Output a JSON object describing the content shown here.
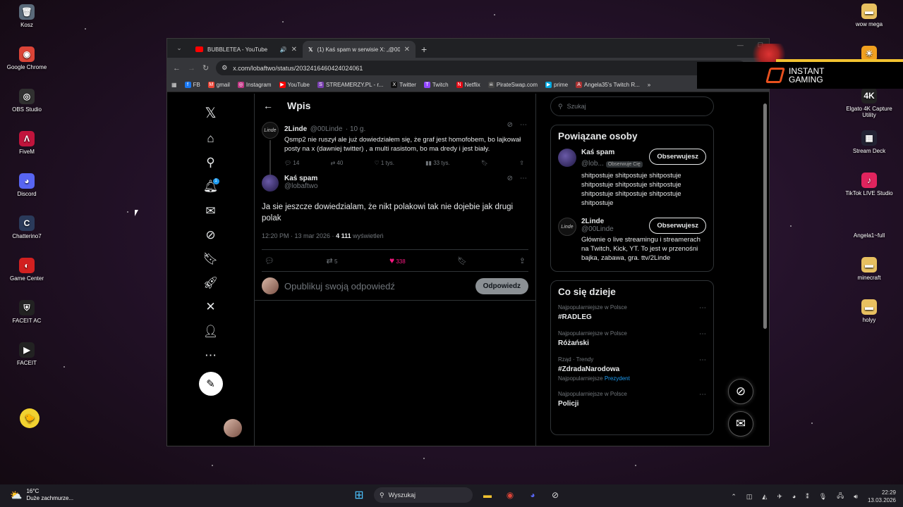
{
  "desktop": {
    "left_icons": [
      {
        "label": "Kosz",
        "icon": "recycle-bin-icon",
        "color": "#5a6a7a",
        "glyph": "🗑"
      },
      {
        "label": "Google Chrome",
        "icon": "chrome-icon",
        "color": "#db4437",
        "glyph": "◉"
      },
      {
        "label": "OBS Studio",
        "icon": "obs-icon",
        "color": "#303030",
        "glyph": "◎"
      },
      {
        "label": "FiveM",
        "icon": "fivem-icon",
        "color": "#c0143c",
        "glyph": "Λ"
      },
      {
        "label": "Discord",
        "icon": "discord-icon",
        "color": "#5865f2",
        "glyph": "◕"
      },
      {
        "label": "Chatterino7",
        "icon": "chatterino-icon",
        "color": "#2a3a5a",
        "glyph": "C"
      },
      {
        "label": "Game Center",
        "icon": "game-center-icon",
        "color": "#d22020",
        "glyph": "◐"
      },
      {
        "label": "FACEIT AC",
        "icon": "faceit-ac-icon",
        "color": "#222",
        "glyph": "⛨"
      },
      {
        "label": "FACEIT",
        "icon": "faceit-icon",
        "color": "#222",
        "glyph": "▶"
      }
    ],
    "right_icons": [
      {
        "label": "wow mega",
        "icon": "folder-icon",
        "color": "#e8c060",
        "glyph": "▬"
      },
      {
        "label": "",
        "icon": "sun-app-icon",
        "color": "#f0a020",
        "glyph": "☀"
      },
      {
        "label": "Elgato 4K Capture Utility",
        "icon": "elgato-icon",
        "color": "#222",
        "glyph": "4K"
      },
      {
        "label": "Stream Deck",
        "icon": "stream-deck-icon",
        "color": "#223",
        "glyph": "▦"
      },
      {
        "label": "TikTok LIVE Studio",
        "icon": "tiktok-icon",
        "color": "#e0245e",
        "glyph": "♪"
      },
      {
        "label": "Angela1~full",
        "icon": "file-icon",
        "color": "transparent",
        "glyph": ""
      },
      {
        "label": "minecraft",
        "icon": "folder-icon",
        "color": "#e8c060",
        "glyph": "▬"
      },
      {
        "label": "holyy",
        "icon": "folder-icon",
        "color": "#e8c060",
        "glyph": "▬"
      }
    ]
  },
  "browser": {
    "tabs": [
      {
        "title": "BUBBLETEA - YouTube",
        "icon": "youtube-icon"
      },
      {
        "title": "(1) Kaś spam w serwisie X: „@00",
        "icon": "x-icon"
      }
    ],
    "url": "x.com/lobaftwo/status/2032416460424024061",
    "bookmarks": [
      {
        "label": "FB",
        "color": "#1877f2",
        "glyph": "f"
      },
      {
        "label": "gmail",
        "color": "#ea4335",
        "glyph": "M"
      },
      {
        "label": "Instagram",
        "color": "#c13584",
        "glyph": "◎"
      },
      {
        "label": "YouTube",
        "color": "#ff0000",
        "glyph": "▶"
      },
      {
        "label": "STREAMERZY.PL - r...",
        "color": "#7a3fb0",
        "glyph": "S"
      },
      {
        "label": "Twitter",
        "color": "#111",
        "glyph": "X"
      },
      {
        "label": "Twitch",
        "color": "#9146ff",
        "glyph": "T"
      },
      {
        "label": "Netflix",
        "color": "#e50914",
        "glyph": "N"
      },
      {
        "label": "PirateSwap.com",
        "color": "#444",
        "glyph": "☠"
      },
      {
        "label": "prime",
        "color": "#00a8e1",
        "glyph": "▶"
      },
      {
        "label": "Angela35's Twitch R...",
        "color": "#a33",
        "glyph": "A"
      }
    ]
  },
  "ad": {
    "line1": "INSTANT",
    "line2": "GAMING"
  },
  "x": {
    "header": "Wpis",
    "parent": {
      "name": "2Linde",
      "handle": "@00Linde",
      "time": "· 10 g.",
      "avatar_text": "Linde",
      "text": "Qsmp2 nie ruszył ale już dowiedziałem się, że graf jest homofobem, bo lajkował posty na x (dawniej twitter) , a multi rasistom, bo ma dredy i jest biały.",
      "replies": "14",
      "reposts": "40",
      "likes": "1 tys.",
      "views": "33 tys."
    },
    "main": {
      "name": "Kaś spam",
      "handle": "@lobaftwo",
      "text": "Ja sie jeszcze dowiedzialam, że nikt polakowi tak nie dojebie jak drugi polak",
      "datetime": "12:20 PM · 13 mar 2026 ·",
      "views_count": "4 111",
      "views_label": "wyświetleń",
      "reposts": "5",
      "likes": "338"
    },
    "reply": {
      "placeholder": "Opublikuj swoją odpowiedź",
      "button": "Odpowiedz"
    },
    "notif_badge": "1",
    "search_placeholder": "Szukaj",
    "related": {
      "title": "Powiązane osoby",
      "people": [
        {
          "name": "Kaś spam",
          "handle": "@lob...",
          "tag": "Obserwuje Cię",
          "follow": "Obserwujesz",
          "bio": "shitpostuje shitpostuje shitpostuje shitpostuje shitpostuje shitpostuje shitpostuje shitpostuje shitpostuje shitpostuje"
        },
        {
          "name": "2Linde",
          "handle": "@00Linde",
          "tag": "",
          "follow": "Obserwujesz",
          "bio": "Głównie o live streamingu i streamerach na Twitch, Kick, YT. To jest w przenośni bajka, zabawa, gra. ttv/2Linde"
        }
      ]
    },
    "trends": {
      "title": "Co się dzieje",
      "items": [
        {
          "category": "Najpopularniejsze w Polsce",
          "name": "#RADLEG",
          "sub": "",
          "sub_link": ""
        },
        {
          "category": "Najpopularniejsze w Polsce",
          "name": "Różański",
          "sub": "",
          "sub_link": ""
        },
        {
          "category": "Rząd · Trendy",
          "name": "#ZdradaNarodowa",
          "sub": "Najpopularniejsze",
          "sub_link": "Prezydent"
        },
        {
          "category": "Najpopularniejsze w Polsce",
          "name": "Policji",
          "sub": "",
          "sub_link": ""
        }
      ]
    }
  },
  "taskbar": {
    "temp": "16°C",
    "weather": "Duże zachmurze...",
    "search": "Wyszukaj",
    "time": "22:29",
    "date": "13.03.2026"
  }
}
